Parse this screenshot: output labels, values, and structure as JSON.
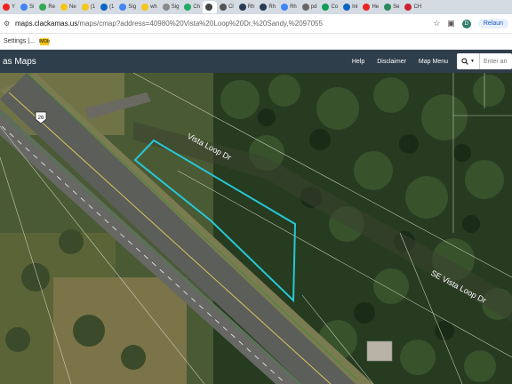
{
  "browser": {
    "tabs": [
      {
        "icon": "youtube-icon",
        "label": "Y",
        "color": "#e22"
      },
      {
        "icon": "google-icon",
        "label": "Si",
        "color": "#4285f4"
      },
      {
        "icon": "google-icon",
        "label": "Re",
        "color": "#34a853"
      },
      {
        "icon": "imdb-icon",
        "label": "Ne",
        "color": "#f5c518"
      },
      {
        "icon": "imdb-icon",
        "label": "(1",
        "color": "#f5c518"
      },
      {
        "icon": "linkedin-icon",
        "label": "(1",
        "color": "#0a66c2"
      },
      {
        "icon": "google-icon",
        "label": "Sig",
        "color": "#4285f4"
      },
      {
        "icon": "imdb-icon",
        "label": "wh",
        "color": "#f5c518"
      },
      {
        "icon": "loader-icon",
        "label": "Sig",
        "color": "#888"
      },
      {
        "icon": "arrow-icon",
        "label": "Ch",
        "color": "#2a6"
      },
      {
        "icon": "map-icon",
        "label": "",
        "color": "#444"
      },
      {
        "icon": "map-icon",
        "label": "Cl",
        "color": "#555"
      },
      {
        "icon": "realtor-icon",
        "label": "Rh",
        "color": "#2b3b55"
      },
      {
        "icon": "realtor-icon",
        "label": "Rh",
        "color": "#2b3b55"
      },
      {
        "icon": "google-icon",
        "label": "Rh",
        "color": "#4285f4"
      },
      {
        "icon": "map-icon",
        "label": "pd",
        "color": "#666"
      },
      {
        "icon": "sheet-icon",
        "label": "Co",
        "color": "#0f9d58"
      },
      {
        "icon": "linkedin-icon",
        "label": "Inl",
        "color": "#0a66c2"
      },
      {
        "icon": "youtube-icon",
        "label": "He",
        "color": "#e22"
      },
      {
        "icon": "triangle-icon",
        "label": "Se",
        "color": "#2a8a5c"
      },
      {
        "icon": "circle-icon",
        "label": "CH",
        "color": "#c23"
      }
    ],
    "active_tab_index": 10,
    "url_host": "maps.clackamas.us",
    "url_path": "/maps/cmap?address=40980%20Vista%20Loop%20Dr,%20Sandy,%2097055",
    "avatar_letter": "D",
    "relaunch_label": "Relaun",
    "bookmarks": [
      "Settings |...",
      "IMDb"
    ]
  },
  "app": {
    "title": "as Maps",
    "nav": [
      "Help",
      "Disclaimer",
      "Map Menu"
    ],
    "search_placeholder": "Enter an"
  },
  "map": {
    "highway_shield": "26",
    "road_labels": [
      "Vista Loop Dr",
      "SE Vista Loop Dr"
    ],
    "parcel_color": "#27c7d6"
  }
}
